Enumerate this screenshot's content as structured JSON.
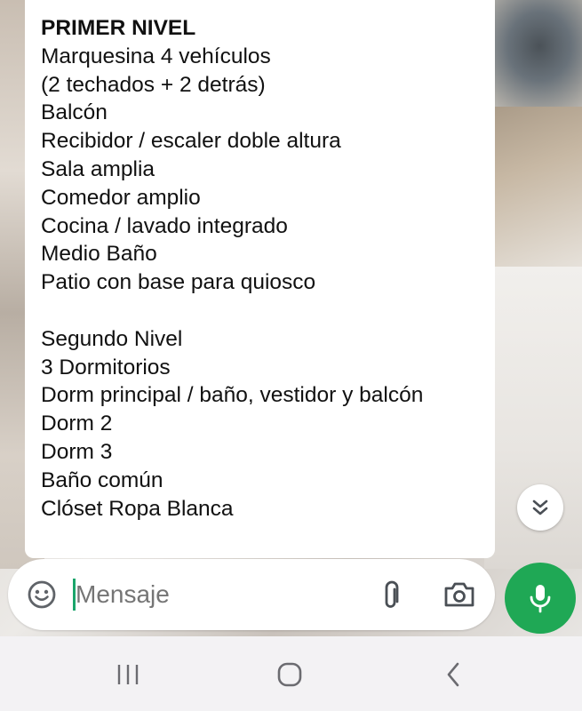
{
  "message": {
    "lines": [
      "PRIMER NIVEL",
      "Marquesina 4 vehículos",
      "(2 techados + 2 detrás)",
      "Balcón",
      "Recibidor / escaler doble altura",
      "Sala amplia",
      "Comedor amplio",
      "Cocina / lavado integrado",
      "Medio Baño",
      "Patio con base para quiosco",
      "",
      "Segundo Nivel",
      "3 Dormitorios",
      "Dorm principal / baño, vestidor y balcón",
      "Dorm 2",
      "Dorm 3",
      "Baño común",
      "Clóset Ropa Blanca"
    ]
  },
  "composer": {
    "placeholder": "Mensaje",
    "emoji_icon": "emoji-icon",
    "attach_icon": "paperclip-icon",
    "camera_icon": "camera-icon",
    "mic_icon": "microphone-icon"
  },
  "scroll_down": {
    "icon": "double-chevron-down-icon"
  },
  "navbar": {
    "recents_icon": "recents-icon",
    "home_icon": "home-icon",
    "back_icon": "back-icon"
  },
  "colors": {
    "accent_green": "#1fa855",
    "caret_green": "#1aa56b",
    "bubble": "#ffffff",
    "navbar": "#f3f2f4"
  }
}
